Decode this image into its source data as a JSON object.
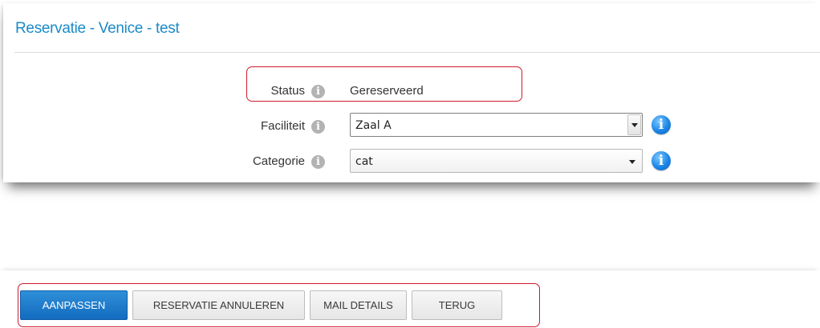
{
  "page": {
    "title": "Reservatie - Venice - test"
  },
  "form": {
    "status": {
      "label": "Status",
      "value": "Gereserveerd"
    },
    "facility": {
      "label": "Faciliteit",
      "value": "Zaal A"
    },
    "category": {
      "label": "Categorie",
      "value": "cat"
    }
  },
  "icons": {
    "info_grey": "info-circle-icon",
    "info_blue": "info-circle-blue-icon",
    "glyph": "i"
  },
  "buttons": {
    "edit": "AANPASSEN",
    "cancel_reservation": "RESERVATIE ANNULEREN",
    "mail_details": "MAIL DETAILS",
    "back": "TERUG"
  },
  "colors": {
    "title": "#1a8bc9",
    "highlight": "#cc1b2b",
    "primary_button": "#1e7acb"
  }
}
